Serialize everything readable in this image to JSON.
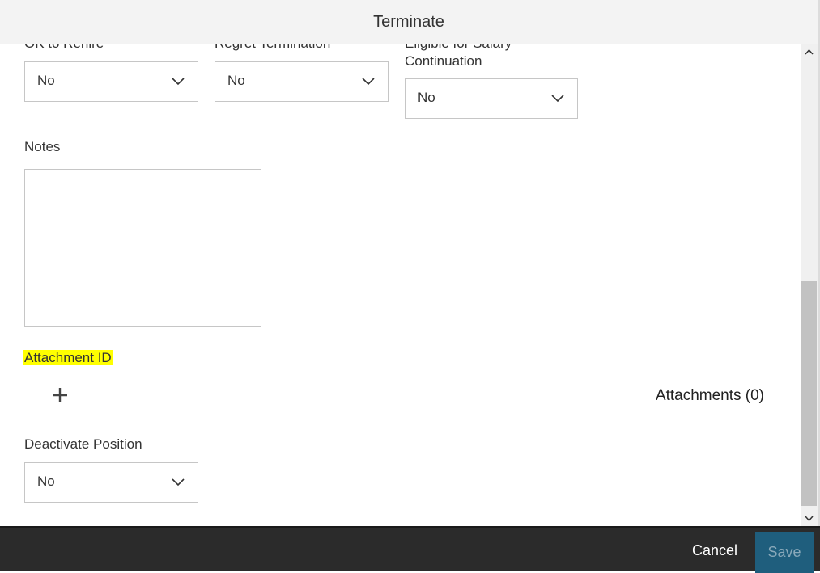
{
  "dialog": {
    "title": "Terminate"
  },
  "fields": {
    "ok_to_rehire": {
      "label": "OK to Rehire",
      "value": "No"
    },
    "regret_termination": {
      "label": "Regret Termination",
      "value": "No"
    },
    "eligible_salary_continuation": {
      "label_line1": "Eligible for Salary",
      "label_line2": "Continuation",
      "value": "No"
    },
    "notes": {
      "label": "Notes",
      "value": ""
    },
    "attachment_id": {
      "label": "Attachment ID",
      "highlight_color": "#ffff00"
    },
    "attachments": {
      "count_label": "Attachments (0)"
    },
    "deactivate_position": {
      "label": "Deactivate Position",
      "value": "No"
    }
  },
  "icons": {
    "add": "plus-icon",
    "dropdown": "chevron-down-icon",
    "scroll_up": "chevron-up-icon",
    "scroll_down": "chevron-down-icon"
  },
  "footer": {
    "cancel_label": "Cancel",
    "save_label": "Save"
  },
  "colors": {
    "footer_bg": "#2b2b2b",
    "save_bg": "#1f5e7d",
    "header_bg": "#f3f3f3"
  }
}
